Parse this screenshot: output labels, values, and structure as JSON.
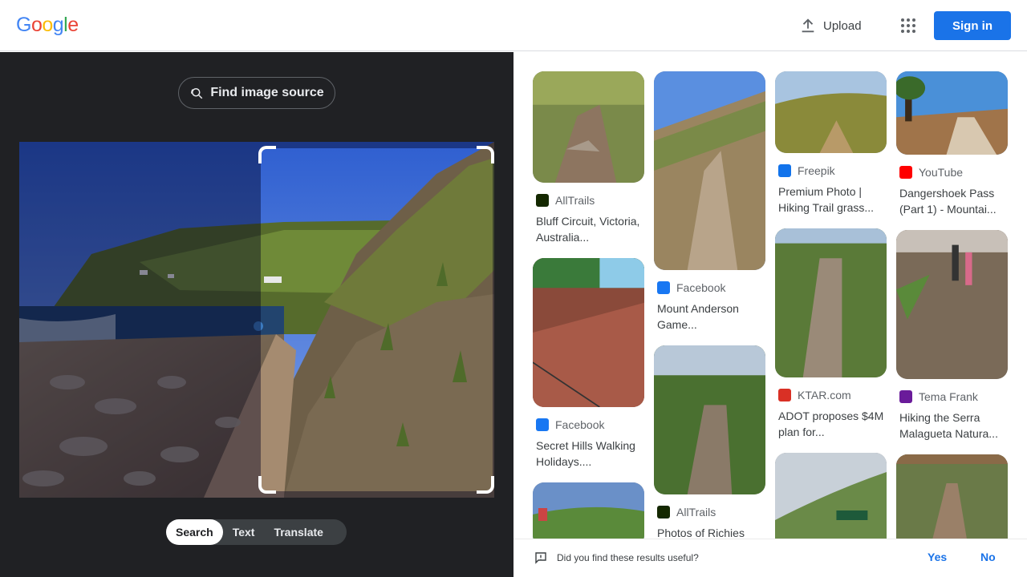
{
  "header": {
    "logo_letters": [
      {
        "ch": "G",
        "color": "#4285F4"
      },
      {
        "ch": "o",
        "color": "#EA4335"
      },
      {
        "ch": "o",
        "color": "#FBBC05"
      },
      {
        "ch": "g",
        "color": "#4285F4"
      },
      {
        "ch": "l",
        "color": "#34A853"
      },
      {
        "ch": "e",
        "color": "#EA4335"
      }
    ],
    "upload_label": "Upload",
    "upload_icon": "upload-icon",
    "apps_icon": "apps-grid-icon",
    "signin_label": "Sign in",
    "accent": "#1a73e8"
  },
  "lens": {
    "find_source_label": "Find image source",
    "find_source_icon": "image-search-icon",
    "modes": [
      {
        "label": "Search",
        "active": true
      },
      {
        "label": "Text",
        "active": false
      },
      {
        "label": "Translate",
        "active": false
      }
    ]
  },
  "results": {
    "columns": [
      [
        {
          "source": "AllTrails",
          "favicon": "alltrails-icon",
          "fav_color": "#142800",
          "title": "Bluff Circuit, Victoria, Australia...",
          "img": "trail-rocky"
        },
        {
          "source": "Facebook",
          "favicon": "facebook-icon",
          "fav_color": "#1877f2",
          "title": "Secret Hills Walking Holidays....",
          "img": "red-hill"
        },
        {
          "source": "",
          "favicon": "",
          "fav_color": "",
          "title": "",
          "img": "coast-hiker"
        }
      ],
      [
        {
          "source": "Facebook",
          "favicon": "facebook-icon",
          "fav_color": "#1877f2",
          "title": "Mount Anderson Game...",
          "img": "stone-path"
        },
        {
          "source": "AllTrails",
          "favicon": "alltrails-icon",
          "fav_color": "#142800",
          "title": "Photos of Richies",
          "img": "green-rocky"
        }
      ],
      [
        {
          "source": "Freepik",
          "favicon": "freepik-icon",
          "fav_color": "#1273eb",
          "title": "Premium Photo | Hiking Trail grass...",
          "img": "valley"
        },
        {
          "source": "KTAR.com",
          "favicon": "ktar-icon",
          "fav_color": "#d93025",
          "title": "ADOT proposes $4M plan for...",
          "img": "gravel-trail"
        },
        {
          "source": "",
          "favicon": "",
          "fav_color": "",
          "title": "",
          "img": "sign-hill"
        }
      ],
      [
        {
          "source": "YouTube",
          "favicon": "youtube-icon",
          "fav_color": "#ff0000",
          "title": "Dangershoek Pass (Part 1) - Mountai...",
          "img": "road-tree"
        },
        {
          "source": "Tema Frank",
          "favicon": "tema-frank-icon",
          "fav_color": "#6a1b9a",
          "title": "Hiking the Serra Malagueta Natura...",
          "img": "hikers"
        },
        {
          "source": "",
          "favicon": "",
          "fav_color": "",
          "title": "",
          "img": "scrub-trail"
        }
      ]
    ]
  },
  "feedback": {
    "question": "Did you find these results useful?",
    "yes_label": "Yes",
    "no_label": "No"
  }
}
